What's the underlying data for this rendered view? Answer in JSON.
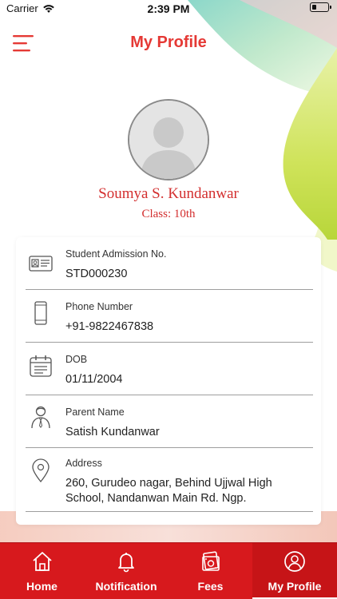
{
  "status_bar": {
    "carrier": "Carrier",
    "time": "2:39 PM"
  },
  "header": {
    "title": "My Profile"
  },
  "profile": {
    "name": "Soumya S. Kundanwar",
    "class_label": "Class: 10th"
  },
  "fields": [
    {
      "label": "Student Admission No.",
      "value": "STD000230",
      "icon": "id-card-icon"
    },
    {
      "label": "Phone Number",
      "value": "+91-9822467838",
      "icon": "phone-icon"
    },
    {
      "label": "DOB",
      "value": "01/11/2004",
      "icon": "calendar-icon"
    },
    {
      "label": "Parent Name",
      "value": "Satish Kundanwar",
      "icon": "parent-icon"
    },
    {
      "label": "Address",
      "value_lines": [
        "260, Gurudeo nagar, Behind Ujjwal High",
        "School, Nandanwan Main Rd. Ngp."
      ],
      "icon": "location-pin-icon"
    }
  ],
  "bottom_nav": {
    "items": [
      {
        "label": "Home",
        "icon": "home-icon"
      },
      {
        "label": "Notification",
        "icon": "bell-icon"
      },
      {
        "label": "Fees",
        "icon": "money-icon"
      },
      {
        "label": "My Profile",
        "icon": "profile-icon",
        "active": true
      }
    ]
  },
  "colors": {
    "accent": "#e53935",
    "nav_background": "#d7191d",
    "name_color": "#d32f2f"
  }
}
